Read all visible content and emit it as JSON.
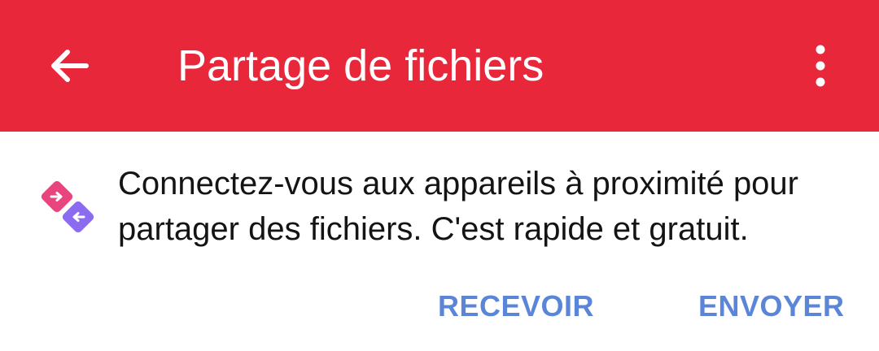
{
  "appbar": {
    "title": "Partage de fichiers",
    "back_icon": "arrow-left-icon",
    "more_icon": "more-vertical-icon",
    "background_color": "#e8283a"
  },
  "card": {
    "icon": "nearby-share-icon",
    "message": "Connectez-vous aux appareils à proximité pour partager des fichiers. C'est rapide et gratuit.",
    "receive_label": "RECEVOIR",
    "send_label": "ENVOYER",
    "action_color": "#5b86d8"
  }
}
